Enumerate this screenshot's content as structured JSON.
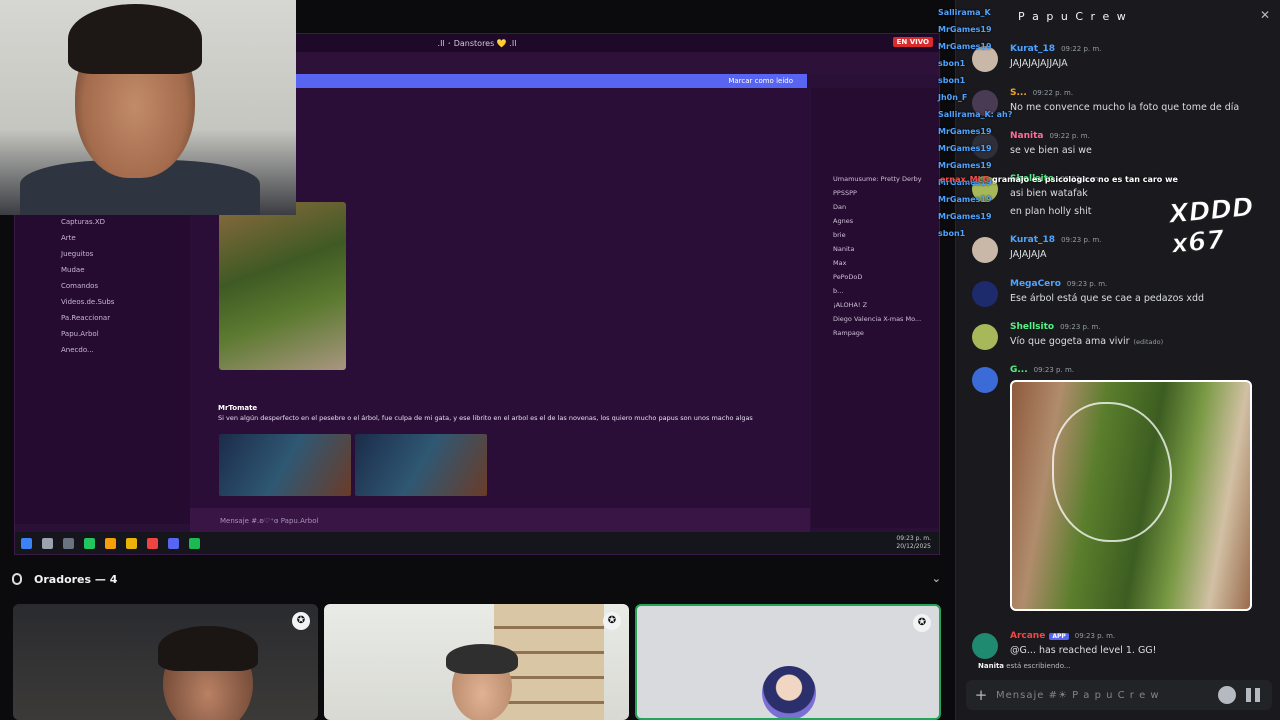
{
  "stage": {
    "share_title": ".Il ･ Danstores 💛 .Il",
    "live_label": "EN VIVO",
    "mark_read": "Marcar como leído",
    "composer_placeholder": "Mensaje #.ʚ♡⁺ɞ Papu.Arbol",
    "share_message_author": "MrTomate",
    "share_message_text": "Si ven algún desperfecto en el pesebre o el árbol, fue culpa de mi gata, y ese librito en el arbol es el de las novenas, los quiero mucho papus son unos macho algas",
    "channels": [
      "Capturas.XD",
      "Arte",
      "Jueguitos",
      "Mudae",
      "Comandos",
      "Videos.de.Subs",
      "Pa.Reaccionar",
      "Papu.Arbol",
      "Anecdo..."
    ],
    "members": [
      "Umamusume: Pretty Derby",
      "PPSSPP",
      "Dan",
      "Agnes",
      "brie",
      "Nanita",
      "Max",
      "PePoDoD",
      "b...",
      "¡ALOHA! Z",
      "Diego Valencia X-mas Mo...",
      "Rampage"
    ],
    "clock_time": "09:23 p. m.",
    "clock_date": "20/12/2025"
  },
  "speakers": {
    "label": "Oradores — 4"
  },
  "chat": {
    "title": "P a p u C r e w",
    "composer_placeholder": "Mensaje #☀ P a p u C r e w",
    "typing_user": "Nanita",
    "typing_text": "está escribiendo...",
    "messages": [
      {
        "name": "Kurat_18",
        "time": "09:22 p. m.",
        "text": "JAJAJAJAJJAJA",
        "color": "#4fa3ff"
      },
      {
        "name": "S...",
        "time": "09:22 p. m.",
        "text": "No me convence mucho la foto que tome de día",
        "color": "#f5a623"
      },
      {
        "name": "Nanita",
        "time": "09:22 p. m.",
        "text": "se ve bien asi we",
        "color": "#ff6b9a"
      },
      {
        "name": "Shellsito",
        "time": "09:22 p. m.",
        "text": "asi bien watafak",
        "color": "#57f287"
      },
      {
        "name": "",
        "time": "",
        "text": "en plan holly shit",
        "color": "#57f287"
      },
      {
        "name": "Kurat_18",
        "time": "09:23 p. m.",
        "text": "JAJAJAJA",
        "color": "#4fa3ff"
      },
      {
        "name": "MegaCero",
        "time": "09:23 p. m.",
        "text": "Ese árbol está que se cae a pedazos xdd",
        "color": "#4fa3ff"
      },
      {
        "name": "Shellsito",
        "time": "09:23 p. m.",
        "text": "Vío que gogeta ama vivir",
        "color": "#57f287",
        "edited": "(editado)"
      },
      {
        "name": "G...",
        "time": "09:23 p. m.",
        "text": "",
        "color": "#57f287"
      },
      {
        "name": "Arcane",
        "time": "09:23 p. m.",
        "text": "@G... has reached level 1. GG!",
        "color": "#f04747",
        "badge": "APP"
      }
    ]
  },
  "overlay": {
    "names": [
      "Sallirama_K",
      "MrGames19",
      "MrGames19",
      "sbon1",
      "sbon1",
      "Jh0n_F",
      "Sallirama_K: ah?",
      "MrGames19",
      "MrGames19",
      "MrGames19",
      "MrGames19",
      "MrGames19",
      "MrGames19",
      "sbon1"
    ],
    "highlight_user": "ernax_MLG",
    "highlight_text": "gramajo es psicologico no es tan caro we",
    "xd_text": "XDDD x67"
  }
}
